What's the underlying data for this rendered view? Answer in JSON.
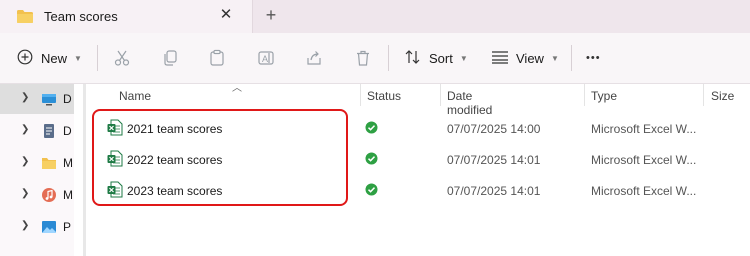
{
  "window": {
    "tab_title": "Team scores",
    "close_glyph": "✕",
    "new_tab_glyph": "+"
  },
  "toolbar": {
    "new_label": "New",
    "sort_label": "Sort",
    "view_label": "View",
    "more_glyph": "•••",
    "icons": [
      "plus-circle-icon",
      "cut-icon",
      "copy-icon",
      "paste-icon",
      "rename-icon",
      "share-icon",
      "delete-icon",
      "sort-icon",
      "view-icon",
      "more-icon"
    ]
  },
  "nav": {
    "items": [
      {
        "label": "D",
        "icon": "desktop-icon",
        "selected": true
      },
      {
        "label": "D",
        "icon": "documents-icon",
        "selected": false
      },
      {
        "label": "M",
        "icon": "folder-icon",
        "selected": false
      },
      {
        "label": "M",
        "icon": "music-icon",
        "selected": false
      },
      {
        "label": "P",
        "icon": "pictures-icon",
        "selected": false
      }
    ]
  },
  "columns": {
    "name": "Name",
    "status": "Status",
    "date_modified": "Date modified",
    "type": "Type",
    "size": "Size"
  },
  "files": [
    {
      "name": "2021 team scores",
      "date": "07/07/2025 14:00",
      "type": "Microsoft Excel W...",
      "size": "",
      "status": "synced"
    },
    {
      "name": "2022 team scores",
      "date": "07/07/2025 14:01",
      "type": "Microsoft Excel W...",
      "size": "",
      "status": "synced"
    },
    {
      "name": "2023 team scores",
      "date": "07/07/2025 14:01",
      "type": "Microsoft Excel W...",
      "size": "",
      "status": "synced"
    }
  ],
  "colors": {
    "status_green": "#2ea043",
    "excel_green": "#1d7a44",
    "highlight_red": "#e01818"
  }
}
